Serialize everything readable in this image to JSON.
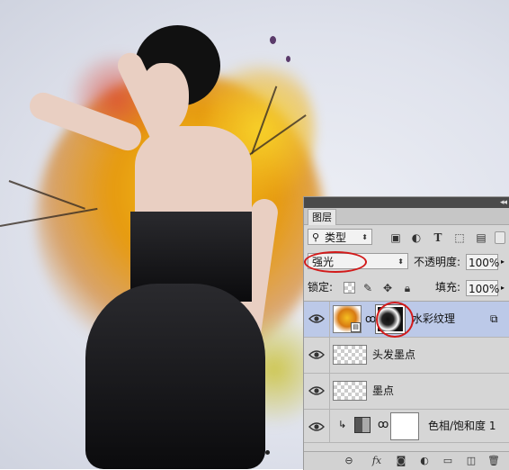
{
  "layers_panel": {
    "tab_label": "图层",
    "filter": {
      "label": "类型",
      "icon": "search-icon"
    },
    "filter_icons": [
      "image-filter-icon",
      "adjustment-filter-icon",
      "text-filter-icon",
      "shape-filter-icon",
      "smart-object-filter-icon"
    ],
    "blend_mode": "强光",
    "opacity_label": "不透明度:",
    "opacity_value": "100%",
    "lock_label": "锁定:",
    "fill_label": "填充:",
    "fill_value": "100%",
    "layers": [
      {
        "name": "水彩纹理",
        "selected": true,
        "thumb": "smart-object",
        "has_mask": true
      },
      {
        "name": "头发墨点",
        "selected": false,
        "thumb": "transparent",
        "has_mask": false
      },
      {
        "name": "墨点",
        "selected": false,
        "thumb": "transparent",
        "has_mask": false
      },
      {
        "name": "色相/饱和度 1",
        "selected": false,
        "thumb": "adjustment",
        "has_mask": true
      }
    ],
    "footer_buttons": [
      "link-icon",
      "fx",
      "mask-icon",
      "adjustment-icon",
      "folder-icon",
      "new-layer-icon",
      "trash-icon"
    ],
    "footer_fx_label": "fx"
  },
  "colors": {
    "panel_bg": "#d6d6d6",
    "selected_layer": "#bcc9e8",
    "annotation_red": "#d21a1a"
  }
}
